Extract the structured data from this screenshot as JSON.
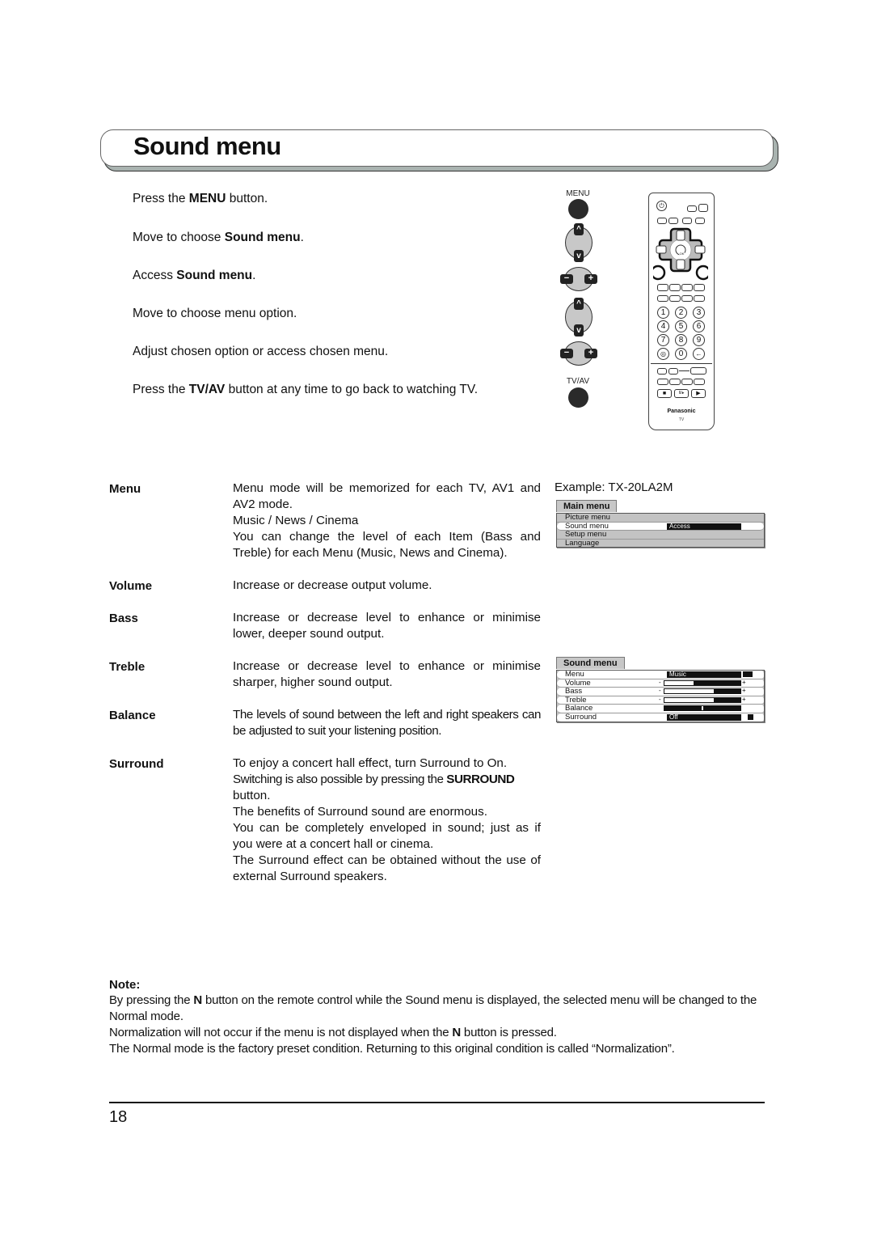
{
  "page": {
    "title": "Sound menu",
    "page_number": "18"
  },
  "steps": [
    {
      "pre": "Press the ",
      "bold": "MENU",
      "post": " button."
    },
    {
      "pre": "Move to choose ",
      "bold": "Sound menu",
      "post": "."
    },
    {
      "pre": "Access ",
      "bold": "Sound menu",
      "post": "."
    },
    {
      "pre": "Move to choose menu option.",
      "bold": "",
      "post": ""
    },
    {
      "pre": "Adjust chosen option or access chosen menu.",
      "bold": "",
      "post": ""
    },
    {
      "pre": "Press the ",
      "bold": "TV/AV",
      "post": " button at any time to go back to watching TV."
    }
  ],
  "button_labels": {
    "menu": "MENU",
    "tvav": "TV/AV",
    "up": "^",
    "down": "v",
    "minus": "−",
    "plus": "+"
  },
  "remote": {
    "brand": "Panasonic",
    "model_label": "TV",
    "ok_label": "OK",
    "numbers": [
      "1",
      "2",
      "3",
      "4",
      "5",
      "6",
      "7",
      "8",
      "9",
      "◎",
      "0",
      "←"
    ],
    "transport": [
      "■",
      "II/▸",
      "▶"
    ]
  },
  "terms": [
    {
      "term": "Menu",
      "lines": [
        "Menu mode will be memorized for each TV, AV1 and AV2 mode.",
        "Music / News / Cinema",
        "You can change the level of each Item (Bass and Treble) for each Menu (Music, News and Cinema)."
      ]
    },
    {
      "term": "Volume",
      "lines": [
        "Increase or decrease output volume."
      ]
    },
    {
      "term": "Bass",
      "lines": [
        "Increase or decrease level to enhance or minimise lower, deeper sound output."
      ]
    },
    {
      "term": "Treble",
      "lines": [
        "Increase or decrease level to enhance or minimise sharper, higher sound output."
      ]
    },
    {
      "term": "Balance",
      "lines": [
        "The levels of sound between the left and right speakers can be adjusted to suit your listening position."
      ]
    },
    {
      "term": "Surround",
      "lines": [
        "To enjoy a concert hall effect, turn Surround to On.",
        "button.",
        "The benefits of Surround sound are enormous.",
        "You can be completely enveloped in sound; just as if you were at a concert hall or cinema.",
        "The Surround effect can be obtained without the use of external Surround speakers."
      ],
      "surround_line2_pre": "Switching is also possible by pressing the ",
      "surround_line2_bold": "SURROUND"
    }
  ],
  "example": {
    "label": "Example: TX-20LA2M",
    "main_menu": {
      "title": "Main menu",
      "items": [
        "Picture menu",
        "Sound menu",
        "Setup menu",
        "Language"
      ],
      "selected_index": 1,
      "selected_value": "Access"
    },
    "sound_menu": {
      "title": "Sound menu",
      "items": [
        {
          "label": "Menu",
          "type": "value",
          "value": "Music"
        },
        {
          "label": "Volume",
          "type": "bar",
          "level": 0.38,
          "minus": "-",
          "plus": "+"
        },
        {
          "label": "Bass",
          "type": "bar",
          "level": 0.65,
          "minus": "-",
          "plus": "+"
        },
        {
          "label": "Treble",
          "type": "bar",
          "level": 0.65,
          "minus": "-",
          "plus": "+"
        },
        {
          "label": "Balance",
          "type": "balance",
          "level": 0.5
        },
        {
          "label": "Surround",
          "type": "value",
          "value": "Off"
        }
      ]
    }
  },
  "note": {
    "heading": "Note:",
    "para1_pre": "By pressing the ",
    "para1_bold": "N",
    "para1_post": " button on the remote control while the Sound menu is displayed, the selected menu will be changed to the Normal mode.",
    "para2_pre": "Normalization will not occur if the menu is not displayed when the ",
    "para2_bold": "N",
    "para2_post": " button is pressed.",
    "para3": "The Normal mode is the factory preset condition. Returning to this original condition is called “Normalization”."
  }
}
